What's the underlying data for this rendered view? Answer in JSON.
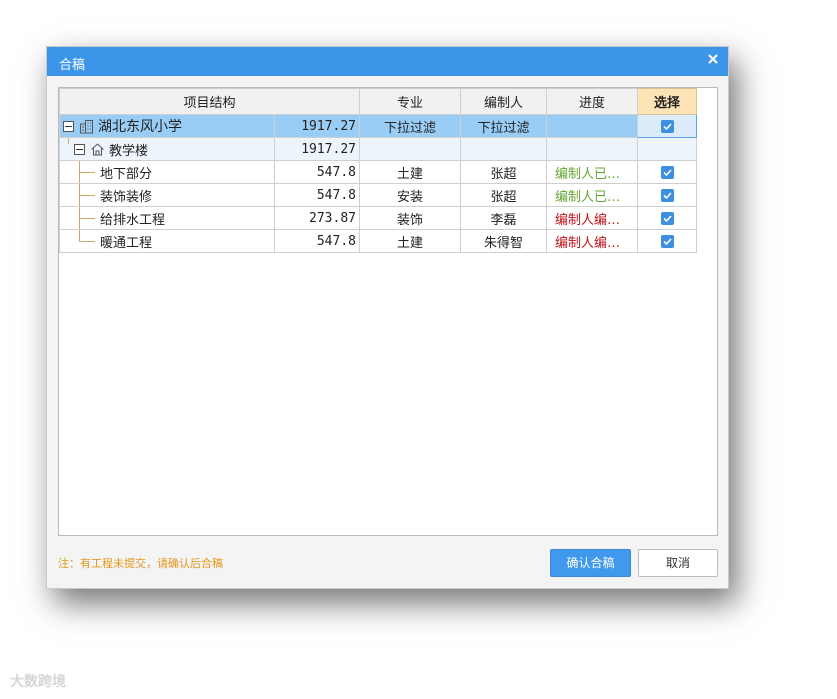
{
  "dialog": {
    "title": "合稿",
    "close_icon": "close-icon"
  },
  "table": {
    "headers": {
      "structure": "项目结构",
      "major": "专业",
      "editor": "编制人",
      "progress": "进度",
      "select": "选择"
    },
    "root": {
      "name": "湖北东风小学",
      "amount": "1917.27",
      "major": "下拉过滤",
      "editor": "下拉过滤",
      "icon": "building-icon",
      "checked": true
    },
    "building": {
      "name": "教学楼",
      "amount": "1917.27",
      "icon": "home-icon"
    },
    "rows": [
      {
        "name": "地下部分",
        "amount": "547.8",
        "major": "土建",
        "editor": "张超",
        "progress": "编制人已…",
        "progress_color": "#66a633",
        "checked": true
      },
      {
        "name": "装饰装修",
        "amount": "547.8",
        "major": "安装",
        "editor": "张超",
        "progress": "编制人已…",
        "progress_color": "#66a633",
        "checked": true
      },
      {
        "name": "给排水工程",
        "amount": "273.87",
        "major": "装饰",
        "editor": "李磊",
        "progress": "编制人编…",
        "progress_color": "#c0141a",
        "checked": true
      },
      {
        "name": "暖通工程",
        "amount": "547.8",
        "major": "土建",
        "editor": "朱得智",
        "progress": "编制人编…",
        "progress_color": "#c0141a",
        "checked": true
      }
    ]
  },
  "footer": {
    "note": "注：有工程未提交，请确认后合稿",
    "confirm_label": "确认合稿",
    "cancel_label": "取消"
  },
  "watermark": "大数跨境",
  "colors": {
    "titlebar": "#3d95ea",
    "root_row": "#99cdf6",
    "select_header": "#fde3b6",
    "note": "#e7951a",
    "primary_button": "#4199ee"
  }
}
